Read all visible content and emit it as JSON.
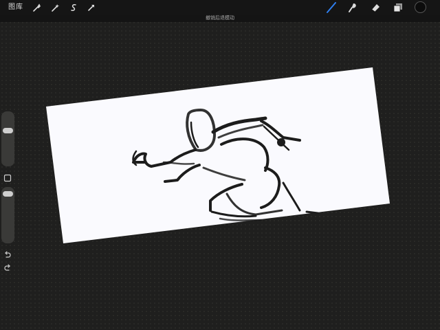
{
  "topbar": {
    "gallery_label": "图库",
    "tools_left": [
      {
        "icon": "wrench-icon"
      },
      {
        "icon": "magic-wand-icon"
      },
      {
        "icon": "selection-icon"
      },
      {
        "icon": "move-arrow-icon"
      }
    ],
    "tools_right": [
      {
        "icon": "brush-icon"
      },
      {
        "icon": "smudge-icon"
      },
      {
        "icon": "eraser-icon"
      },
      {
        "icon": "layers-icon"
      }
    ],
    "active_tool": "brush-icon",
    "color_value": "#0c0c0c",
    "accent_color": "#2f7ff0"
  },
  "canvas": {
    "title": "撤销后退模动",
    "background_color": "#fafafe",
    "stroke_color": "#1c1c1c"
  },
  "sidebar": {
    "brush_size_icon": "brush-size-slider",
    "modify_button_icon": "square-modify-icon",
    "opacity_icon": "opacity-slider",
    "undo_icon": "undo-icon",
    "redo_icon": "redo-icon"
  }
}
